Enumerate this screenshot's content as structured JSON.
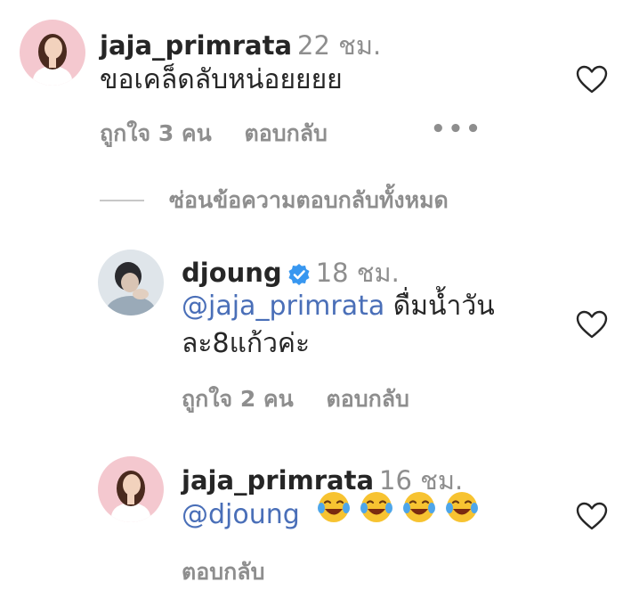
{
  "comments": [
    {
      "username": "jaja_primrata",
      "time": "22 ชม.",
      "text": "ขอเคล็ดลับหน่อยยยย",
      "likes": "ถูกใจ 3 คน",
      "reply": "ตอบกลับ",
      "more": "•••"
    }
  ],
  "hide_replies": "ซ่อนข้อความตอบกลับทั้งหมด",
  "replies": [
    {
      "username": "djoung",
      "verified": true,
      "time": "18 ชม.",
      "mention": "@jaja_primrata",
      "text_line1": " ดื่มน้ำวัน",
      "text_line2": "ละ8แก้วค่ะ",
      "likes": "ถูกใจ 2 คน",
      "reply": "ตอบกลับ"
    },
    {
      "username": "jaja_primrata",
      "time": "16 ชม.",
      "mention": "@djoung",
      "emojis": [
        "face-with-tears-of-joy",
        "face-with-tears-of-joy",
        "face-with-tears-of-joy",
        "face-with-tears-of-joy"
      ],
      "reply": "ตอบกลับ"
    }
  ],
  "colors": {
    "text": "#262626",
    "secondary": "#8e8e8e",
    "mention": "#4a6fb8",
    "verified": "#3897f0"
  }
}
